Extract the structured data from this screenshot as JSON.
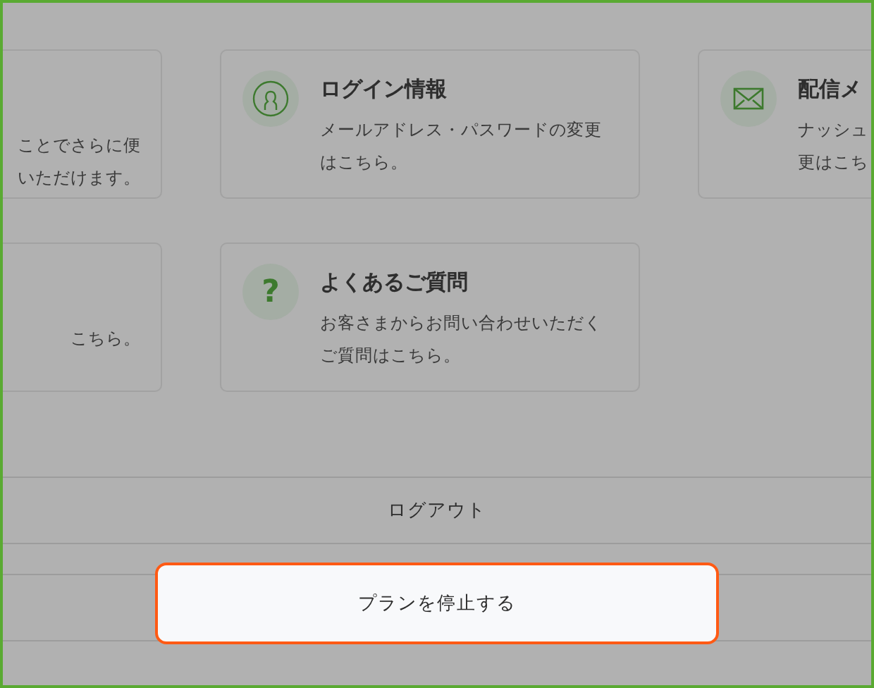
{
  "card_rows": [
    [
      {
        "lines": [
          "ことでさらに便",
          "いただけます。"
        ]
      },
      {
        "kind": "user",
        "title": "ログイン情報",
        "lines": [
          "メールアドレス・パスワードの変更",
          "はこちら。"
        ]
      },
      {
        "kind": "mail",
        "title": "配信メ",
        "lines": [
          "ナッシュ",
          "更はこち"
        ]
      }
    ],
    [
      {
        "lines": [
          "こちら。"
        ]
      },
      {
        "kind": "glyph",
        "icon_glyph": "?",
        "title": "よくあるご質問",
        "lines": [
          "お客さまからお問い合わせいただく",
          "ご質問はこちら。"
        ]
      }
    ]
  ],
  "logout": {
    "label": "ログアウト"
  },
  "stop_plan_button": {
    "label": "プランを停止する"
  }
}
